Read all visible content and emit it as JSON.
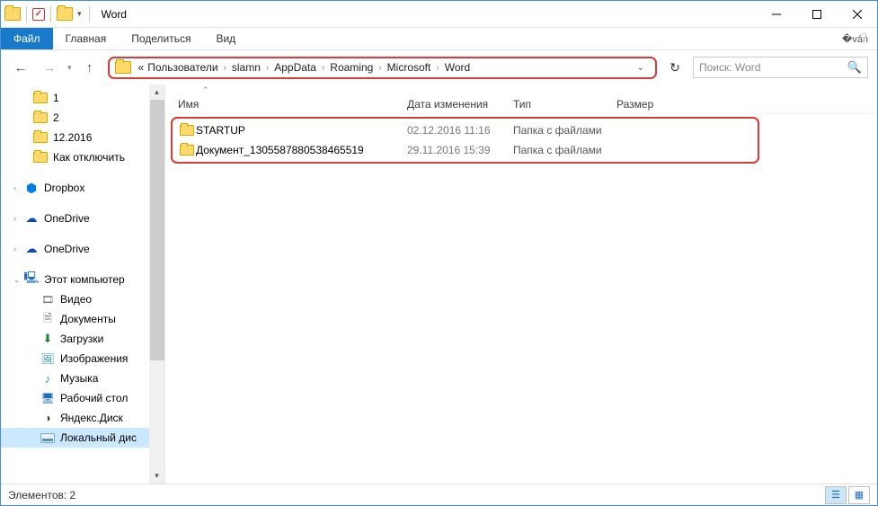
{
  "window": {
    "title": "Word"
  },
  "ribbon": {
    "file": "Файл",
    "tabs": [
      "Главная",
      "Поделиться",
      "Вид"
    ]
  },
  "breadcrumbs": [
    "Пользователи",
    "slamn",
    "AppData",
    "Roaming",
    "Microsoft",
    "Word"
  ],
  "search": {
    "placeholder": "Поиск: Word"
  },
  "columns": {
    "name": "Имя",
    "date": "Дата изменения",
    "type": "Тип",
    "size": "Размер"
  },
  "rows": [
    {
      "name": "STARTUP",
      "date": "02.12.2016 11:16",
      "type": "Папка с файлами",
      "size": ""
    },
    {
      "name": "Документ_1305587880538465519",
      "date": "29.11.2016 15:39",
      "type": "Папка с файлами",
      "size": ""
    }
  ],
  "sidebar": {
    "quick": [
      "1",
      "2",
      "12.2016",
      "Как отключить"
    ],
    "dropbox": "Dropbox",
    "onedrive1": "OneDrive",
    "onedrive2": "OneDrive",
    "thispc": "Этот компьютер",
    "pcchildren": [
      "Видео",
      "Документы",
      "Загрузки",
      "Изображения",
      "Музыка",
      "Рабочий стол",
      "Яндекс.Диск",
      "Локальный дис"
    ]
  },
  "statusbar": {
    "count_label": "Элементов: 2"
  }
}
